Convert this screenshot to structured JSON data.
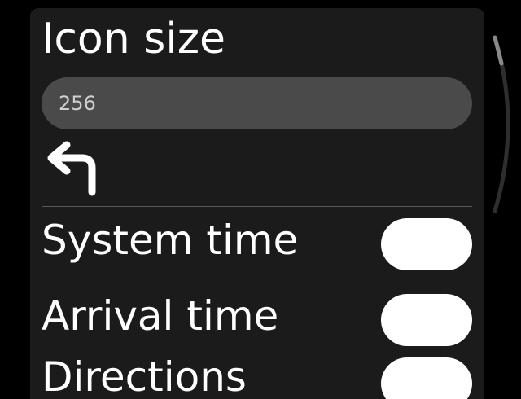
{
  "settings": {
    "icon_size": {
      "title": "Icon size",
      "value": "256",
      "preview_icon": "turn-left-arrow-icon"
    },
    "toggles": [
      {
        "label": "System time"
      },
      {
        "label": "Arrival time"
      },
      {
        "label": "Directions"
      }
    ]
  },
  "colors": {
    "page_background": "#000000",
    "panel_background": "#1b1b1b",
    "input_background": "#4a4a4a",
    "toggle": "#ffffff",
    "text": "#ffffff",
    "divider": "#5a5a5a"
  }
}
